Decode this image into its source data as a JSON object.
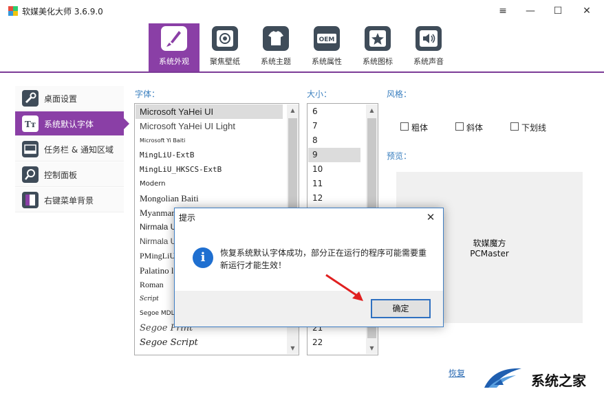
{
  "window": {
    "title": "软媒美化大师 3.6.9.0",
    "menu_icon": "≡",
    "min_icon": "—",
    "max_icon": "☐",
    "close_icon": "✕"
  },
  "nav": {
    "tabs": [
      {
        "label": "系统外观",
        "icon": "brush-icon",
        "active": true
      },
      {
        "label": "聚焦壁纸",
        "icon": "focus-icon",
        "active": false
      },
      {
        "label": "系统主题",
        "icon": "tshirt-icon",
        "active": false
      },
      {
        "label": "系统属性",
        "icon": "oem-icon",
        "active": false
      },
      {
        "label": "系统图标",
        "icon": "star-icon",
        "active": false
      },
      {
        "label": "系统声音",
        "icon": "speaker-icon",
        "active": false
      }
    ],
    "oem_text": "OEM"
  },
  "sidebar": {
    "items": [
      {
        "label": "桌面设置",
        "active": false
      },
      {
        "label": "系统默认字体",
        "active": true
      },
      {
        "label": "任务栏 & 通知区域",
        "active": false
      },
      {
        "label": "控制面板",
        "active": false
      },
      {
        "label": "右键菜单背景",
        "active": false
      }
    ]
  },
  "font_panel": {
    "label": "字体：",
    "fonts": [
      "Microsoft YaHei UI",
      "Microsoft YaHei UI Light",
      "Microsoft Yi Baiti",
      "MingLiU-ExtB",
      "MingLiU_HKSCS-ExtB",
      "Modern",
      "Mongolian Baiti",
      "Myanmar",
      "Nirmala U",
      "Nirmala U",
      "PMingLiU",
      "Palatino l",
      "Roman",
      "Script",
      "Segoe MDL",
      "Segoe Print",
      "Segoe Script"
    ],
    "selected_index": 0
  },
  "size_panel": {
    "label": "大小：",
    "top_sizes": [
      "6",
      "7",
      "8",
      "9",
      "10",
      "11",
      "12"
    ],
    "bottom_sizes": [
      "21",
      "22"
    ],
    "selected_index": 3
  },
  "style_panel": {
    "label": "风格：",
    "bold": "粗体",
    "italic": "斜体",
    "underline": "下划线"
  },
  "preview": {
    "label": "预览：",
    "line1": "软媒魔方",
    "line2": "PCMaster"
  },
  "restore_link": "恢复",
  "dialog": {
    "title": "提示",
    "message": "恢复系统默认字体成功，部分正在运行的程序可能需要重新运行才能生效！",
    "ok_label": "确定",
    "info_glyph": "i",
    "close_glyph": "✕"
  },
  "watermark": {
    "text": "系统之家"
  },
  "colors": {
    "accent": "#8a3fa6",
    "label_blue": "#3a7fbf",
    "dialog_border": "#3e7ec4"
  }
}
